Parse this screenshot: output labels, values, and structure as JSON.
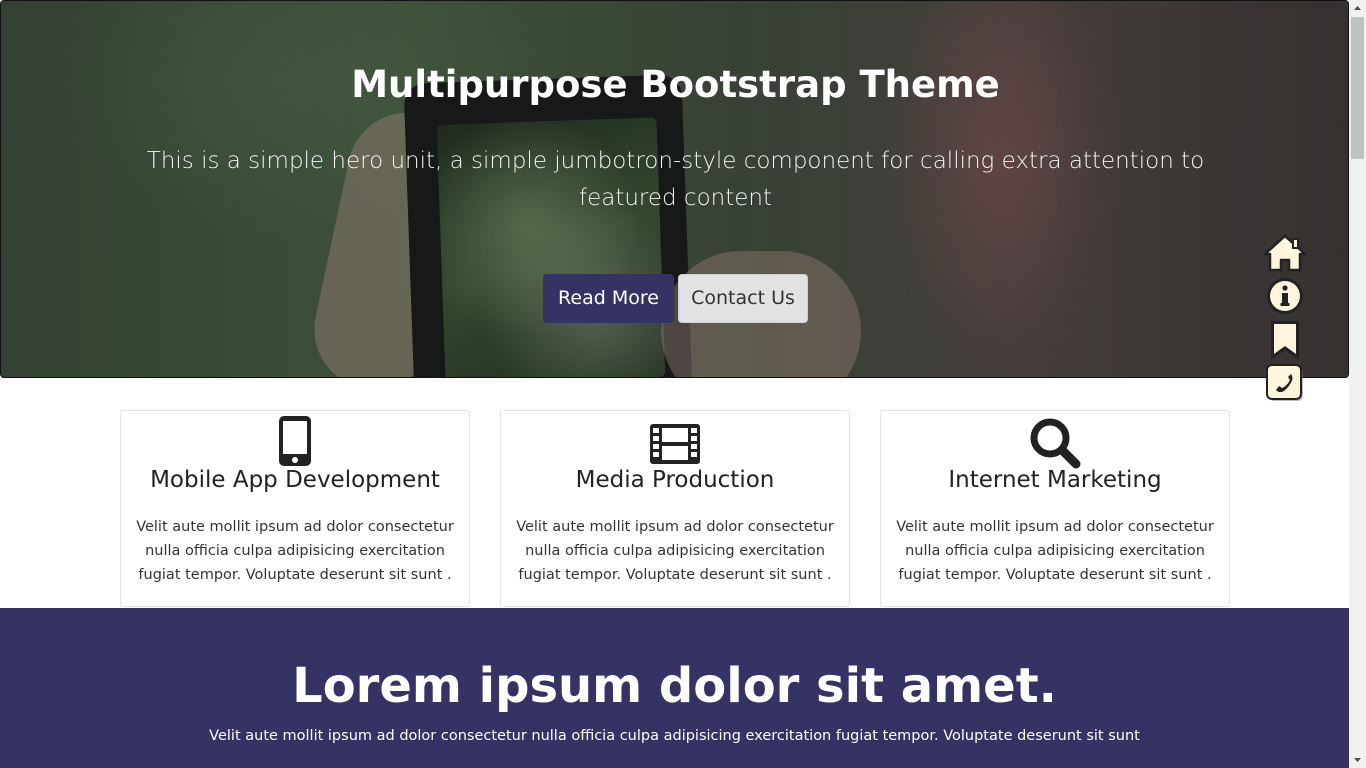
{
  "hero": {
    "title": "Multipurpose Bootstrap Theme",
    "subtitle": "This is a simple hero unit, a simple jumbotron-style component for calling extra attention to featured content",
    "primary_button": "Read More",
    "secondary_button": "Contact Us"
  },
  "side_nav": {
    "items": [
      {
        "icon": "home-icon"
      },
      {
        "icon": "info-icon"
      },
      {
        "icon": "bookmark-icon"
      },
      {
        "icon": "phone-icon"
      }
    ]
  },
  "features": [
    {
      "icon": "mobile-phone-icon",
      "title": "Mobile App Development",
      "text": "Velit aute mollit ipsum ad dolor consectetur nulla officia culpa adipisicing exercitation fugiat tempor. Voluptate deserunt sit sunt ."
    },
    {
      "icon": "film-icon",
      "title": "Media Production",
      "text": "Velit aute mollit ipsum ad dolor consectetur nulla officia culpa adipisicing exercitation fugiat tempor. Voluptate deserunt sit sunt ."
    },
    {
      "icon": "search-icon",
      "title": "Internet Marketing",
      "text": "Velit aute mollit ipsum ad dolor consectetur nulla officia culpa adipisicing exercitation fugiat tempor. Voluptate deserunt sit sunt ."
    }
  ],
  "banner": {
    "title": "Lorem ipsum dolor sit amet.",
    "text": "Velit aute mollit ipsum ad dolor consectetur nulla officia culpa adipisicing exercitation fugiat tempor. Voluptate deserunt sit sunt"
  },
  "colors": {
    "brand": "#353264",
    "secondary_button": "#e2e2e2",
    "icon_fill": "#fdf5dc"
  }
}
